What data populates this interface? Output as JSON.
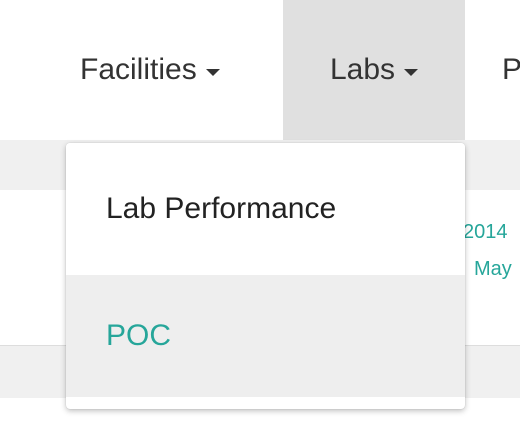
{
  "navbar": {
    "items": [
      {
        "label": "Facilities"
      },
      {
        "label": "Labs"
      },
      {
        "label": "P"
      }
    ]
  },
  "background": {
    "year_fragment": "2014",
    "month_fragment": "May"
  },
  "dropdown": {
    "items": [
      {
        "label": "Lab Performance"
      },
      {
        "label": "POC"
      }
    ]
  },
  "colors": {
    "accent": "#26a69a",
    "active_nav": "#e0e0e0",
    "hover_item": "#eeeeee",
    "text": "#333333"
  }
}
